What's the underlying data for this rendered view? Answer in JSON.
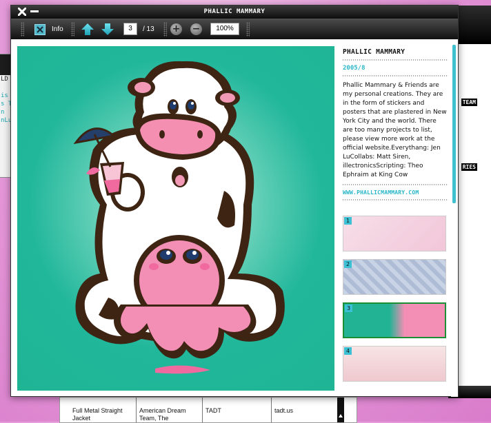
{
  "window": {
    "title": "PHALLIC MAMMARY"
  },
  "toolbar": {
    "info_label": "Info",
    "page_value": "3",
    "page_total": "/ 13",
    "zoom_value": "100%"
  },
  "info": {
    "title": "PHALLIC MAMMARY",
    "date": "2005/8",
    "description": "Phallic Mammary & Friends are my personal creations.  They are in the form of stickers and posters that are plastered in New York City and the world.  There are too many projects to list, please view more work at the official website.Everythang: Jen LuCollabs: Matt Siren, illectronicsScripting: Theo Ephraim at King Cow",
    "link": "WWW.PHALLICMAMMARY.COM"
  },
  "thumbnails": [
    {
      "number": "1"
    },
    {
      "number": "2"
    },
    {
      "number": "3",
      "selected": true
    },
    {
      "number": "4"
    }
  ],
  "background": {
    "left_lines": [
      "LD",
      "is v",
      "s To",
      "n",
      "nLu"
    ],
    "right_tags": [
      "TEAM",
      "RIES"
    ],
    "table": [
      "Full Metal Straight Jacket",
      "American Dream Team, The",
      "TADT",
      "tadt.us"
    ]
  },
  "colors": {
    "art_background": "#1eb494",
    "accent": "#3cc1d4",
    "selected_border": "#1b8f36"
  }
}
